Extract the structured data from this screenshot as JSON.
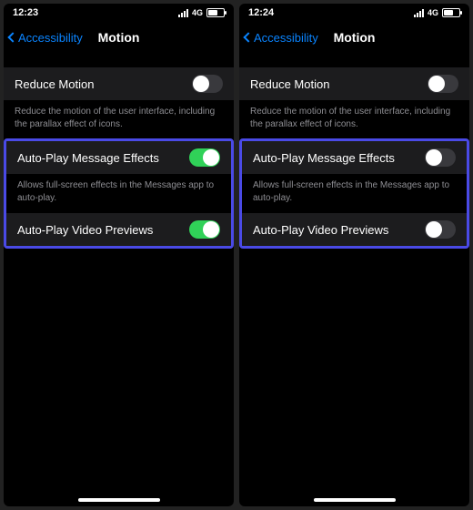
{
  "left": {
    "status": {
      "time": "12:23",
      "network_label": "4G"
    },
    "nav": {
      "back_label": "Accessibility",
      "title": "Motion"
    },
    "reduce_motion": {
      "label": "Reduce Motion",
      "on": false,
      "footer": "Reduce the motion of the user interface, including the parallax effect of icons."
    },
    "auto_play_effects": {
      "label": "Auto-Play Message Effects",
      "on": true,
      "footer": "Allows full-screen effects in the Messages app to auto-play."
    },
    "auto_play_video": {
      "label": "Auto-Play Video Previews",
      "on": true
    }
  },
  "right": {
    "status": {
      "time": "12:24",
      "network_label": "4G"
    },
    "nav": {
      "back_label": "Accessibility",
      "title": "Motion"
    },
    "reduce_motion": {
      "label": "Reduce Motion",
      "on": false,
      "footer": "Reduce the motion of the user interface, including the parallax effect of icons."
    },
    "auto_play_effects": {
      "label": "Auto-Play Message Effects",
      "on": false,
      "footer": "Allows full-screen effects in the Messages app to auto-play."
    },
    "auto_play_video": {
      "label": "Auto-Play Video Previews",
      "on": false
    }
  }
}
